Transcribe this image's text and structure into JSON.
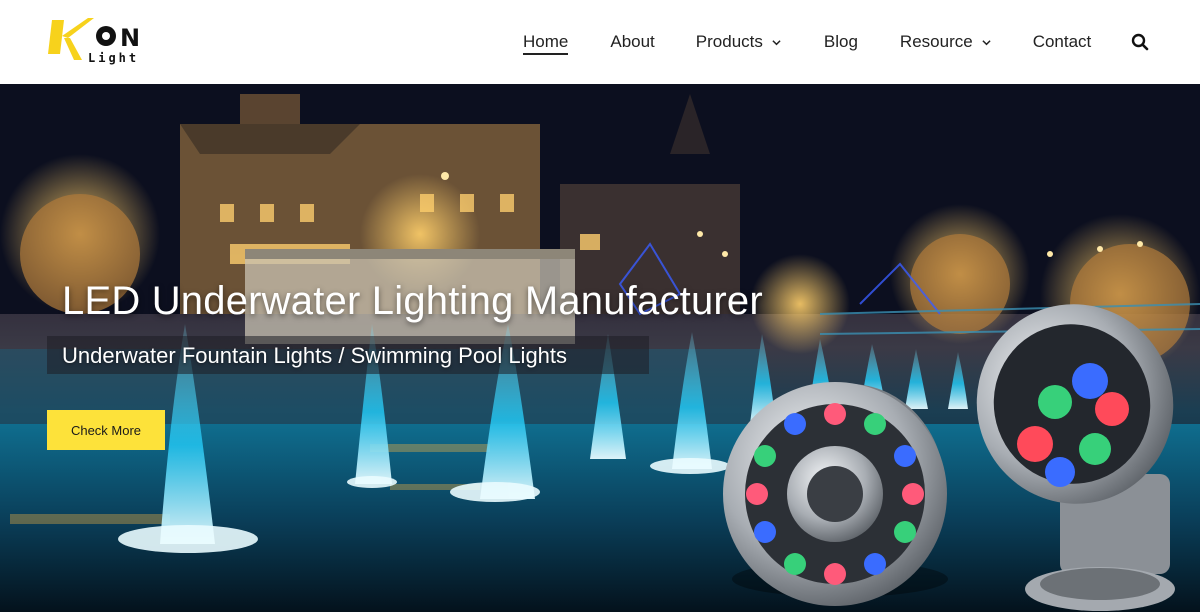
{
  "brand": {
    "logo_text": "KON",
    "logo_subtext": "Light",
    "accent_color": "#f7d21c"
  },
  "nav": {
    "items": [
      {
        "label": "Home",
        "active": true,
        "dropdown": false
      },
      {
        "label": "About",
        "active": false,
        "dropdown": false
      },
      {
        "label": "Products",
        "active": false,
        "dropdown": true
      },
      {
        "label": "Blog",
        "active": false,
        "dropdown": false
      },
      {
        "label": "Resource",
        "active": false,
        "dropdown": true
      },
      {
        "label": "Contact",
        "active": false,
        "dropdown": false
      }
    ],
    "search_icon": "search-icon"
  },
  "hero": {
    "title": "LED Underwater Lighting Manufacturer",
    "subtitle": "Underwater Fountain Lights / Swimming Pool Lights",
    "button_label": "Check More",
    "button_color": "#fde23a"
  }
}
